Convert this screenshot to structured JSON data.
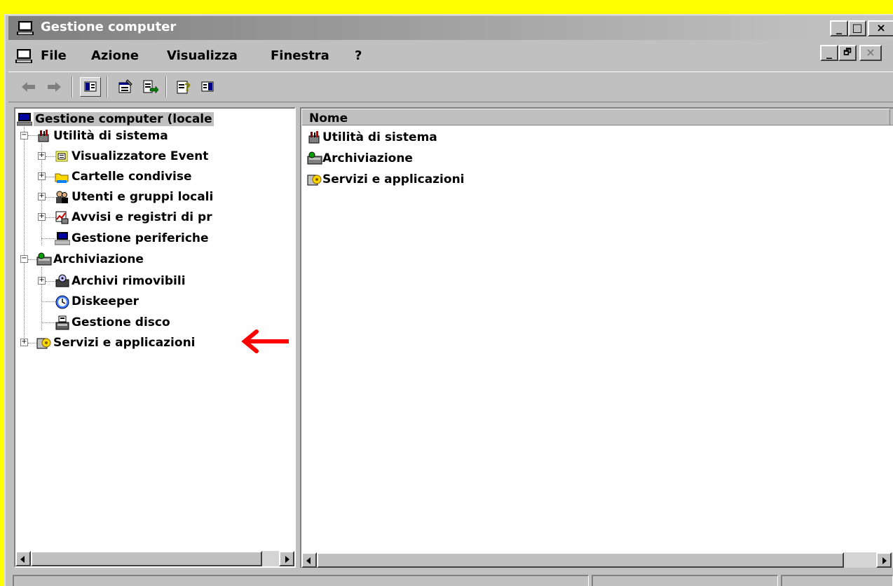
{
  "window": {
    "title": "Gestione computer",
    "title_controls": [
      "_",
      "□",
      "×"
    ],
    "mdi_controls": [
      "_",
      "🗗",
      "×"
    ]
  },
  "menu": {
    "items": [
      "File",
      "Azione",
      "Visualizza",
      "Finestra",
      "?"
    ]
  },
  "toolbar": {
    "buttons": [
      "back-arrow-icon",
      "forward-arrow-icon",
      "show-hide-tree-icon",
      "properties-icon",
      "export-list-icon",
      "help-icon",
      "show-hide-action-pane-icon"
    ]
  },
  "tree": {
    "root": "Gestione computer (locale",
    "system_tools": "Utilità di sistema",
    "event_viewer": "Visualizzatore Event",
    "shared_folders": "Cartelle condivise",
    "local_users": "Utenti e gruppi locali",
    "alerts_logs": "Avvisi e registri di pr",
    "device_manager": "Gestione periferiche",
    "storage": "Archiviazione",
    "removable_storage": "Archivi rimovibili",
    "diskeeper": "Diskeeper",
    "disk_management": "Gestione disco",
    "services_apps": "Servizi e applicazioni"
  },
  "list": {
    "column_header": "Nome",
    "items": [
      "Utilità di sistema",
      "Archiviazione",
      "Servizi e applicazioni"
    ]
  },
  "colors": {
    "border_highlight": "#ffff00",
    "face": "#c0c0c0",
    "annotation_arrow": "#ff0000"
  }
}
